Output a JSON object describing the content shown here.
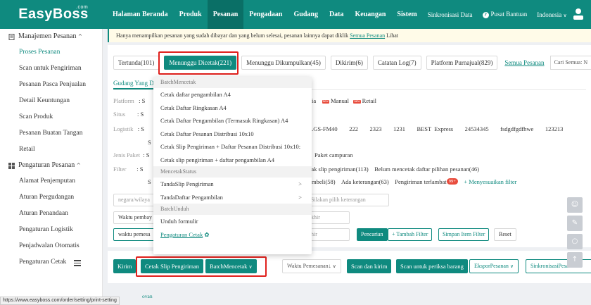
{
  "brand": {
    "logo": "EasyBoss",
    "logo_sup": ".com"
  },
  "nav": {
    "items": [
      "Halaman Beranda",
      "Produk",
      "Pesanan",
      "Pengadaan",
      "Gudang",
      "Data",
      "Keuangan",
      "Sistem"
    ],
    "active": "Pesanan",
    "sync": "Sinkronisasi Data",
    "help": "Pusat Bantuan",
    "language": "Indonesia",
    "help_glyph": "?",
    "chevron": "∨"
  },
  "sidebar": {
    "group1": "Manajemen Pesanan",
    "group1_items": [
      "Proses Pesanan",
      "Scan untuk Pengiriman",
      "Pesanan Pasca Penjualan",
      "Detail Keuntungan",
      "Scan Produk",
      "Pesanan Buatan Tangan",
      "Retail"
    ],
    "group2": "Pengaturan Pesanan",
    "group2_items": [
      "Alamat Penjemputan",
      "Aturan Pergudangan",
      "Aturan Penandaan",
      "Pengaturan Logistik",
      "Penjadwalan Otomatis",
      "Pengaturan Cetak"
    ],
    "caret": "^"
  },
  "url_status": "https://www.easyboss.com/order/setting/print-setting",
  "notice": {
    "text": "Hanya menampilkan pesanan yang sudah dibayar dan yang belum selesai, pesanan lainnya dapat diklik",
    "link": "Semua Pesanan",
    "suffix": "Lihat"
  },
  "tabs": [
    "Tertunda(101)",
    "Menunggu Dicetak(221)",
    "Menunggu Dikumpulkan(45)",
    "Dikirim(6)",
    "Catatan Log(7)",
    "Platform Purnajual(829)"
  ],
  "tabs_link": "Semua Pesanan",
  "search_label": "Cari Semua:",
  "search_cut": "N",
  "subtab": "Gudang Yang D",
  "filters": {
    "platform_label": "Platform",
    "situs_label": "Situs",
    "logistik_label": "Logistik",
    "jenis_label": "Jenis Paket",
    "filter_label": "Filter",
    "s": "S",
    "colon_s": ": S",
    "platform_tail1": "ia",
    "platform_manual": "Manual",
    "platform_retail": "Retail",
    "badge_text": "new",
    "logistik_values": [
      "LGS-FM40",
      "222",
      "2323",
      "1231",
      "BEST Express",
      "24534345",
      "fsdgdfgdfhwe",
      "123213"
    ],
    "jenis_value": "Paket campuran",
    "filter_row1": [
      "tak slip pengiriman(113)",
      "Belum mencetak daftar pilihan pesanan(46)"
    ],
    "filter_row2": [
      "mbeli(58)",
      "Ada keterangan(63)",
      "Pengiriman terlambat"
    ],
    "late_badge": "99+",
    "more_filter": "+ Menyesuaikan filter"
  },
  "inputs": {
    "negara": "negara/wilaya",
    "keterangan": "Silakan pilih keterangan",
    "waktu_pembayaran": "Waktu pembay",
    "akhir": "khir",
    "waktu_pemesanan": "waktu pemesa",
    "hir": "hir"
  },
  "filter_buttons": {
    "search": "Pencarian",
    "add_filter": "+ Tambah Filter",
    "save_filter": "Simpan Item Filter",
    "reset": "Reset"
  },
  "actions": {
    "kirim": "Kirim",
    "cetak_slip": "Cetak Slip Pengiriman",
    "batch_cetak": "BatchMencetak",
    "waktu_pemesanan": "Waktu Pemesanan↓",
    "scan_kirim": "Scan dan kirim",
    "scan_periksa": "Scan untuk periksa barang",
    "ekspor": "EksporPesanan",
    "sinkron": "SinkronisasiPesanan",
    "hidden_suffix": "ovan"
  },
  "dropdown": {
    "sections": [
      {
        "head": "BatchMencetak",
        "items": [
          "Cetak daftar pengambilan A4",
          "Cetak Daftar Ringkasan A4",
          "Cetak Daftar Pengambilan (Termasuk Ringkasan) A4",
          "Cetak Daftar Pesanan Distribusi 10x10",
          "Cetak Slip Pengiriman + Daftar Pesanan Distribusi 10x10:",
          "Cetak slip pengiriman + daftar pengambilan A4"
        ]
      },
      {
        "head": "MencetakStatus",
        "items": [
          "TandaSlip Pengiriman",
          "TandaDaftar Pengambilan"
        ]
      },
      {
        "head": "BatchUnduh",
        "items": [
          "Unduh formulir"
        ]
      }
    ],
    "submenu_arrow": ">",
    "settings_link": "Pengaturan Cetak",
    "settings_glyph": "✿"
  },
  "float_tools": [
    "☺",
    "✎",
    "○",
    "↑"
  ],
  "colors": {
    "brand": "#0f8a7f",
    "highlight": "#e0201c",
    "badge": "#e84c3d"
  }
}
